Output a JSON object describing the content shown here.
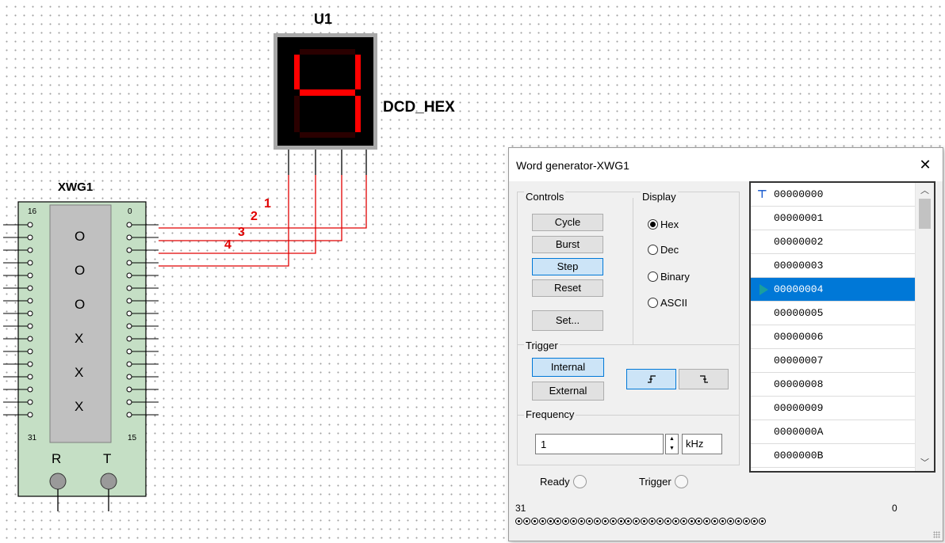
{
  "schematic": {
    "display_label": "U1",
    "display_digit": "4",
    "display_part": "DCD_HEX",
    "generator_label": "XWG1",
    "left_pin_top": "16",
    "left_pin_bottom": "31",
    "right_pin_top": "0",
    "right_pin_bottom": "15",
    "internal_chars": [
      "O",
      "O",
      "O",
      "X",
      "X",
      "X"
    ],
    "wire_labels": [
      "1",
      "2",
      "3",
      "4"
    ],
    "terminal_r": "R",
    "terminal_t": "T",
    "colors": {
      "wire": "#e00000",
      "segment_on": "#ff0000",
      "segment_off": "#2a0000",
      "component_body": "#c5dfc5",
      "display_bg": "#000000"
    }
  },
  "dialog": {
    "title": "Word generator-XWG1",
    "close_icon": "close-icon",
    "controls": {
      "label": "Controls",
      "buttons": [
        "Cycle",
        "Burst",
        "Step",
        "Reset",
        "Set..."
      ],
      "active": "Step"
    },
    "display": {
      "label": "Display",
      "options": [
        "Hex",
        "Dec",
        "Binary",
        "ASCII"
      ],
      "selected": "Hex"
    },
    "trigger": {
      "label": "Trigger",
      "internal": "Internal",
      "external": "External",
      "active_source": "Internal",
      "rising_edge_icon": "rising-edge-icon",
      "falling_edge_icon": "falling-edge-icon",
      "active_edge": "rising"
    },
    "frequency": {
      "label": "Frequency",
      "value": "1",
      "unit": "kHz"
    },
    "words": [
      "00000000",
      "00000001",
      "00000002",
      "00000003",
      "00000004",
      "00000005",
      "00000006",
      "00000007",
      "00000008",
      "00000009",
      "0000000A",
      "0000000B"
    ],
    "selected_word_index": 4,
    "status": {
      "ready": "Ready",
      "trigger": "Trigger"
    },
    "bits": {
      "msb_label": "31",
      "lsb_label": "0",
      "count": 32,
      "value_hex": "00000004"
    },
    "colors": {
      "selection": "#0078d7",
      "active_button": "#cce4f7",
      "marker": "#1a9e9e"
    }
  }
}
